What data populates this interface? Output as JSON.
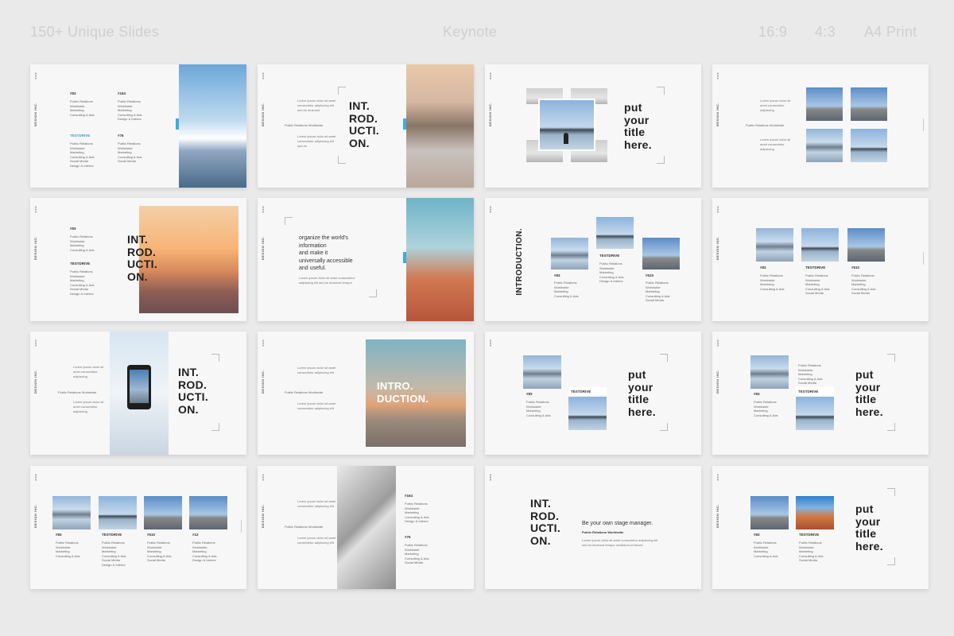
{
  "header": {
    "slides_count": "150+ Unique Slides",
    "format": "Keynote",
    "ratio_169": "16:9",
    "ratio_43": "4:3",
    "a4": "A4 Print"
  },
  "brand": "DESIGN INC.",
  "labels": {
    "n83": "#83",
    "n164": "#164",
    "n76": "#76",
    "n510": "#510",
    "n12": "#12",
    "testdrive": "TESTDRIVE",
    "prw": "Public Relations Worldwide"
  },
  "titles": {
    "intro4": "INT.\nROD.\nUCTI.\nON.",
    "intro2": "INTRO.\nDUCTION.",
    "introv": "INTRODUCTION.",
    "put": "put\nyour\ntitle\nhere.",
    "organize": "organize the world's\ninformation\nand make it\nuniversally accessible\nand useful.",
    "stage": "Be your own stage manager."
  },
  "colors": {
    "accent": "#3aaee0",
    "bg": "#eaeaea",
    "slide": "#f7f7f7"
  }
}
